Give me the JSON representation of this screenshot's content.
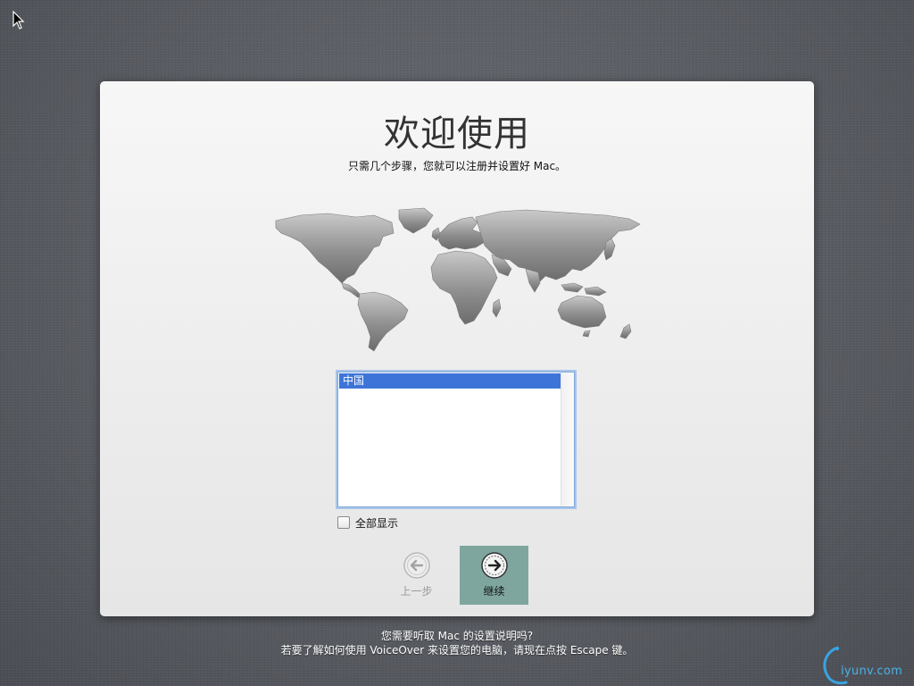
{
  "welcome": {
    "title": "欢迎使用",
    "subtitle": "只需几个步骤，您就可以注册并设置好 Mac。"
  },
  "country_list": {
    "items": [
      {
        "label": "中国",
        "selected": true
      }
    ]
  },
  "show_all": {
    "label": "全部显示",
    "checked": false
  },
  "nav": {
    "back_label": "上一步",
    "continue_label": "继续"
  },
  "footer": {
    "line1": "您需要听取 Mac 的设置说明吗?",
    "line2": "若要了解如何使用 VoiceOver 来设置您的电脑，请现在点按 Escape 键。"
  },
  "watermark": {
    "text": "iyunv.com"
  },
  "colors": {
    "selection": "#3d74d8",
    "continue_button": "#7ea69e",
    "panel": "#ececec",
    "desktop": "#5b5e64"
  }
}
